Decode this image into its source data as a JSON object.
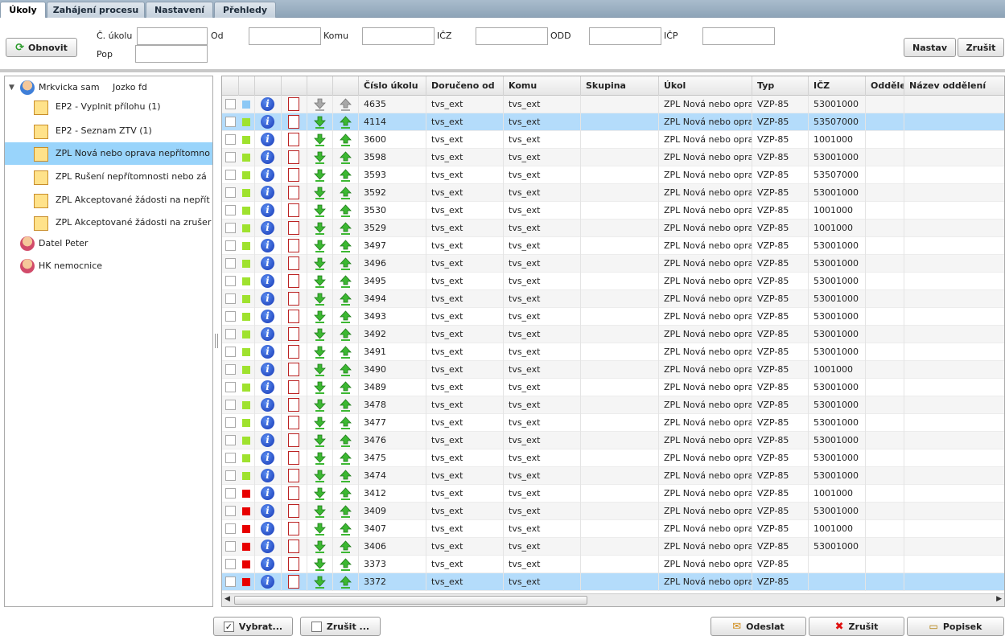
{
  "tabs": [
    "Úkoly",
    "Zahájení procesu",
    "Nastavení",
    "Přehledy"
  ],
  "filter": {
    "refresh_label": "Obnovit",
    "cislo_label": "Č. úkolu",
    "od_label": "Od",
    "komu_label": "Komu",
    "icz_label": "IČZ",
    "odd_label": "ODD",
    "icp_label": "IČP",
    "pop_label": "Pop",
    "set_label": "Nastav",
    "cancel_label": "Zrušit"
  },
  "tree": {
    "user1": "Mrkvicka sam",
    "user1_extra": "Jozko fd",
    "items": [
      "EP2 - Vyplnit přílohu (1)",
      "EP2 - Seznam ZTV (1)",
      "ZPL Nová nebo oprava nepřítomno",
      "ZPL Rušení nepřítomnosti nebo zá",
      "ZPL Akceptované žádosti na nepřít",
      "ZPL Akceptované žádosti na zrušer"
    ],
    "user2": "Datel Peter",
    "user3": "HK nemocnice"
  },
  "grid": {
    "columns": [
      "Číslo úkolu",
      "Doručeno od",
      "Komu",
      "Skupina",
      "Úkol",
      "Typ",
      "IČZ",
      "Odděle",
      "Název oddělení"
    ],
    "rows": [
      {
        "id": "4635",
        "od": "tvs_ext",
        "komu": "tvs_ext",
        "ukol": "ZPL Nová nebo opra",
        "typ": "VZP-85",
        "icz": "53001000",
        "status": "blue",
        "state": "alt"
      },
      {
        "id": "4114",
        "od": "tvs_ext",
        "komu": "tvs_ext",
        "ukol": "ZPL Nová nebo opra",
        "typ": "VZP-85",
        "icz": "53507000",
        "status": "green",
        "state": "sel"
      },
      {
        "id": "3600",
        "od": "tvs_ext",
        "komu": "tvs_ext",
        "ukol": "ZPL Nová nebo opra",
        "typ": "VZP-85",
        "icz": "1001000",
        "status": "green",
        "state": ""
      },
      {
        "id": "3598",
        "od": "tvs_ext",
        "komu": "tvs_ext",
        "ukol": "ZPL Nová nebo opra",
        "typ": "VZP-85",
        "icz": "53001000",
        "status": "green",
        "state": "alt"
      },
      {
        "id": "3593",
        "od": "tvs_ext",
        "komu": "tvs_ext",
        "ukol": "ZPL Nová nebo opra",
        "typ": "VZP-85",
        "icz": "53507000",
        "status": "green",
        "state": ""
      },
      {
        "id": "3592",
        "od": "tvs_ext",
        "komu": "tvs_ext",
        "ukol": "ZPL Nová nebo opra",
        "typ": "VZP-85",
        "icz": "53001000",
        "status": "green",
        "state": "alt"
      },
      {
        "id": "3530",
        "od": "tvs_ext",
        "komu": "tvs_ext",
        "ukol": "ZPL Nová nebo opra",
        "typ": "VZP-85",
        "icz": "1001000",
        "status": "green",
        "state": ""
      },
      {
        "id": "3529",
        "od": "tvs_ext",
        "komu": "tvs_ext",
        "ukol": "ZPL Nová nebo opra",
        "typ": "VZP-85",
        "icz": "1001000",
        "status": "green",
        "state": "alt"
      },
      {
        "id": "3497",
        "od": "tvs_ext",
        "komu": "tvs_ext",
        "ukol": "ZPL Nová nebo opra",
        "typ": "VZP-85",
        "icz": "53001000",
        "status": "green",
        "state": ""
      },
      {
        "id": "3496",
        "od": "tvs_ext",
        "komu": "tvs_ext",
        "ukol": "ZPL Nová nebo opra",
        "typ": "VZP-85",
        "icz": "53001000",
        "status": "green",
        "state": "alt"
      },
      {
        "id": "3495",
        "od": "tvs_ext",
        "komu": "tvs_ext",
        "ukol": "ZPL Nová nebo opra",
        "typ": "VZP-85",
        "icz": "53001000",
        "status": "green",
        "state": ""
      },
      {
        "id": "3494",
        "od": "tvs_ext",
        "komu": "tvs_ext",
        "ukol": "ZPL Nová nebo opra",
        "typ": "VZP-85",
        "icz": "53001000",
        "status": "green",
        "state": "alt"
      },
      {
        "id": "3493",
        "od": "tvs_ext",
        "komu": "tvs_ext",
        "ukol": "ZPL Nová nebo opra",
        "typ": "VZP-85",
        "icz": "53001000",
        "status": "green",
        "state": ""
      },
      {
        "id": "3492",
        "od": "tvs_ext",
        "komu": "tvs_ext",
        "ukol": "ZPL Nová nebo opra",
        "typ": "VZP-85",
        "icz": "53001000",
        "status": "green",
        "state": "alt"
      },
      {
        "id": "3491",
        "od": "tvs_ext",
        "komu": "tvs_ext",
        "ukol": "ZPL Nová nebo opra",
        "typ": "VZP-85",
        "icz": "53001000",
        "status": "green",
        "state": ""
      },
      {
        "id": "3490",
        "od": "tvs_ext",
        "komu": "tvs_ext",
        "ukol": "ZPL Nová nebo opra",
        "typ": "VZP-85",
        "icz": "1001000",
        "status": "green",
        "state": "alt"
      },
      {
        "id": "3489",
        "od": "tvs_ext",
        "komu": "tvs_ext",
        "ukol": "ZPL Nová nebo opra",
        "typ": "VZP-85",
        "icz": "53001000",
        "status": "green",
        "state": ""
      },
      {
        "id": "3478",
        "od": "tvs_ext",
        "komu": "tvs_ext",
        "ukol": "ZPL Nová nebo opra",
        "typ": "VZP-85",
        "icz": "53001000",
        "status": "green",
        "state": "alt"
      },
      {
        "id": "3477",
        "od": "tvs_ext",
        "komu": "tvs_ext",
        "ukol": "ZPL Nová nebo opra",
        "typ": "VZP-85",
        "icz": "53001000",
        "status": "green",
        "state": ""
      },
      {
        "id": "3476",
        "od": "tvs_ext",
        "komu": "tvs_ext",
        "ukol": "ZPL Nová nebo opra",
        "typ": "VZP-85",
        "icz": "53001000",
        "status": "green",
        "state": "alt"
      },
      {
        "id": "3475",
        "od": "tvs_ext",
        "komu": "tvs_ext",
        "ukol": "ZPL Nová nebo opra",
        "typ": "VZP-85",
        "icz": "53001000",
        "status": "green",
        "state": ""
      },
      {
        "id": "3474",
        "od": "tvs_ext",
        "komu": "tvs_ext",
        "ukol": "ZPL Nová nebo opra",
        "typ": "VZP-85",
        "icz": "53001000",
        "status": "green",
        "state": "alt"
      },
      {
        "id": "3412",
        "od": "tvs_ext",
        "komu": "tvs_ext",
        "ukol": "ZPL Nová nebo opra",
        "typ": "VZP-85",
        "icz": "1001000",
        "status": "red",
        "state": ""
      },
      {
        "id": "3409",
        "od": "tvs_ext",
        "komu": "tvs_ext",
        "ukol": "ZPL Nová nebo opra",
        "typ": "VZP-85",
        "icz": "53001000",
        "status": "red",
        "state": "alt"
      },
      {
        "id": "3407",
        "od": "tvs_ext",
        "komu": "tvs_ext",
        "ukol": "ZPL Nová nebo opra",
        "typ": "VZP-85",
        "icz": "1001000",
        "status": "red",
        "state": ""
      },
      {
        "id": "3406",
        "od": "tvs_ext",
        "komu": "tvs_ext",
        "ukol": "ZPL Nová nebo opra",
        "typ": "VZP-85",
        "icz": "53001000",
        "status": "red",
        "state": "alt"
      },
      {
        "id": "3373",
        "od": "tvs_ext",
        "komu": "tvs_ext",
        "ukol": "ZPL Nová nebo opra",
        "typ": "VZP-85",
        "icz": "",
        "status": "red",
        "state": ""
      },
      {
        "id": "3372",
        "od": "tvs_ext",
        "komu": "tvs_ext",
        "ukol": "ZPL Nová nebo opra",
        "typ": "VZP-85",
        "icz": "",
        "status": "red",
        "state": "sel"
      }
    ]
  },
  "status_colors": {
    "blue": "#8cc8f5",
    "green": "#9fe22e",
    "red": "#e80000"
  },
  "footer": {
    "select_label": "Vybrat...",
    "deselect_label": "Zrušit ...",
    "send_label": "Odeslat",
    "cancel_label": "Zrušit",
    "describe_label": "Popisek"
  }
}
